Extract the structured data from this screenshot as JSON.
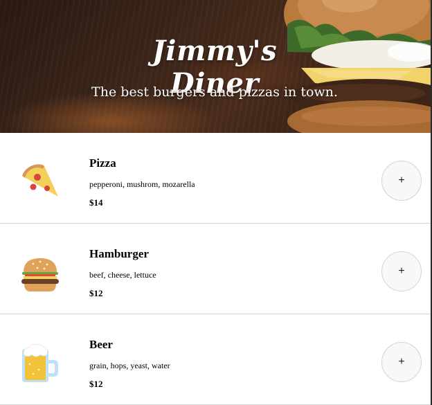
{
  "hero": {
    "title": "Jimmy's Diner",
    "tagline": "The best burgers and pizzas in town."
  },
  "menu": {
    "items": [
      {
        "name": "Pizza",
        "description": "pepperoni, mushrom, mozarella",
        "price": "$14",
        "icon": "pizza-slice-icon",
        "add_label": "+"
      },
      {
        "name": "Hamburger",
        "description": "beef, cheese, lettuce",
        "price": "$12",
        "icon": "hamburger-icon",
        "add_label": "+"
      },
      {
        "name": "Beer",
        "description": "grain, hops, yeast, water",
        "price": "$12",
        "icon": "beer-mug-icon",
        "add_label": "+"
      }
    ]
  },
  "colors": {
    "hero_bg": "#3b2418",
    "divider": "#d6d6d6",
    "button_bg": "#f8f8f8"
  }
}
